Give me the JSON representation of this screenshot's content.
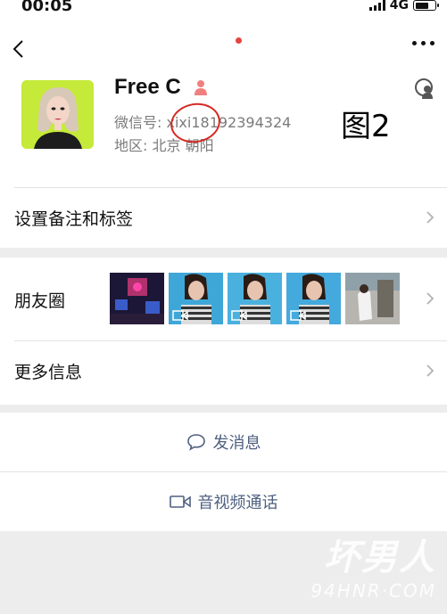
{
  "status_bar": {
    "time": "00:05",
    "network": "4G"
  },
  "profile": {
    "name": "Free C",
    "wechat_id_label": "微信号:",
    "wechat_id": "xixi18192394324",
    "region_label": "地区:",
    "region": "北京 朝阳"
  },
  "annotation": {
    "label": "图2"
  },
  "menu": {
    "remark_label": "设置备注和标签",
    "moments_label": "朋友圈",
    "more_info_label": "更多信息"
  },
  "actions": {
    "send_message": "发消息",
    "video_call": "音视频通话"
  },
  "watermark": {
    "line1": "坏男人",
    "line2": "94HNR·COM"
  },
  "colors": {
    "link_blue": "#4f6080",
    "annotation_red": "#d42a22",
    "avatar_bg": "#c5ea3a"
  }
}
